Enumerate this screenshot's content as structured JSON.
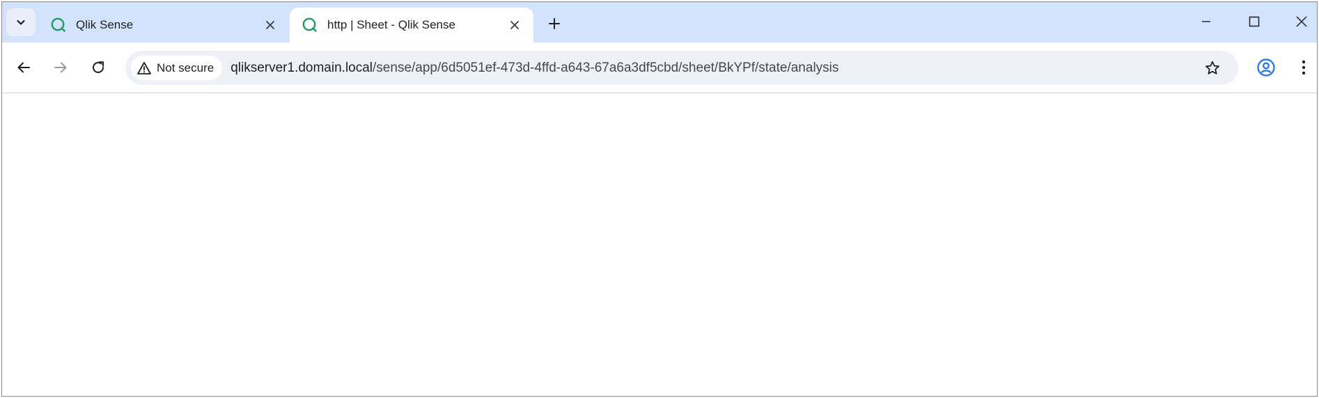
{
  "tabs": [
    {
      "title": "Qlik Sense",
      "active": false,
      "favicon": "qlik-icon"
    },
    {
      "title": "http | Sheet - Qlik Sense",
      "active": true,
      "favicon": "qlik-icon"
    }
  ],
  "address_bar": {
    "security_label": "Not secure",
    "url_host": "qlikserver1.domain.local",
    "url_path": "/sense/app/6d5051ef-473d-4ffd-a643-67a6a3df5cbd/sheet/BkYPf/state/analysis"
  },
  "colors": {
    "tabstrip": "#d3e3fd",
    "omnibox": "#eef2f8",
    "qlik_green": "#1f9c5a",
    "profile_blue": "#1a73e8"
  },
  "icons": [
    "tab-search-icon",
    "qlik-icon",
    "close-icon",
    "plus-icon",
    "minimize-icon",
    "maximize-icon",
    "window-close-icon",
    "back-arrow-icon",
    "forward-arrow-icon",
    "reload-icon",
    "warning-icon",
    "star-icon",
    "profile-icon",
    "more-vert-icon"
  ]
}
